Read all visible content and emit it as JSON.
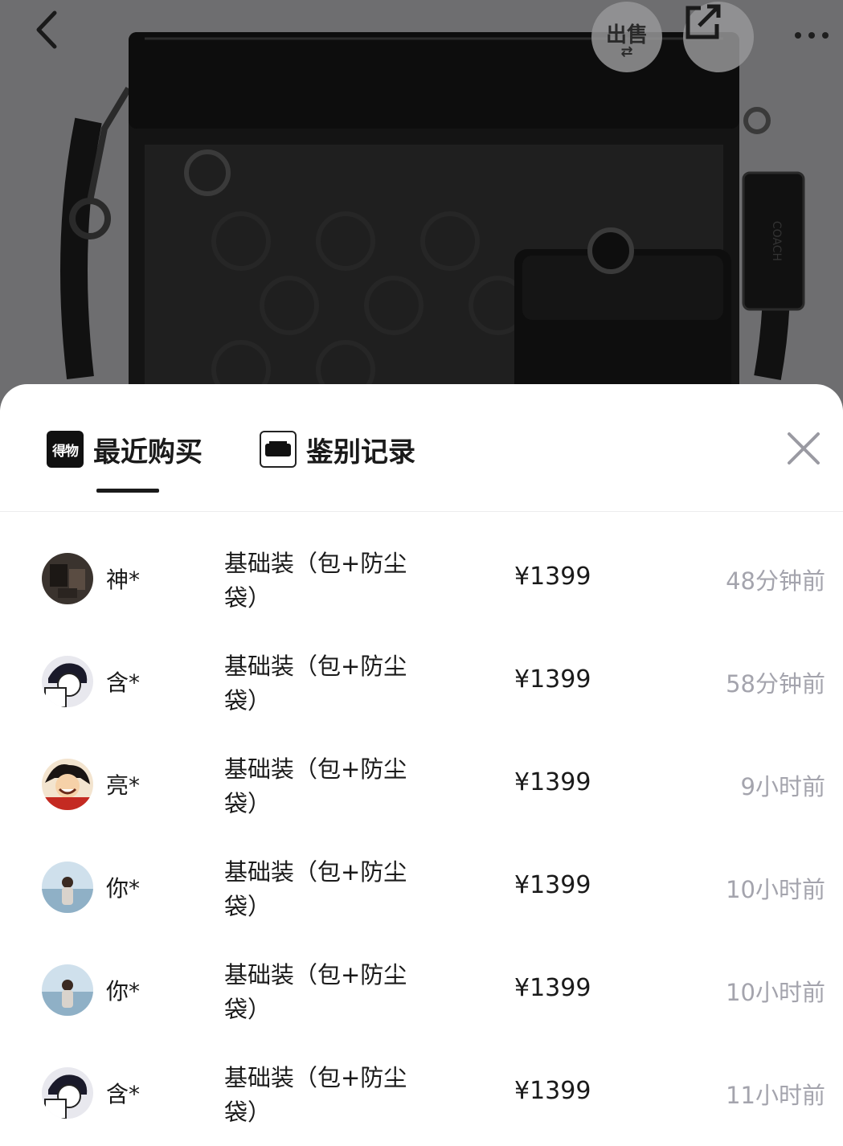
{
  "topbar": {
    "back_icon": "chevron-left-icon",
    "sell_label": "出售",
    "share_icon": "share-arrow-icon",
    "more_icon": "more-dots-icon"
  },
  "product_image": {
    "brand_tag": "COACH"
  },
  "sheet": {
    "tabs": [
      {
        "label": "最近购买",
        "icon_text": "得物",
        "active": true
      },
      {
        "label": "鉴别记录",
        "icon": "bag-thumbnail-icon",
        "active": false
      }
    ],
    "close_icon": "close-icon"
  },
  "records": [
    {
      "user": "神*",
      "spec": "基础装（包+防尘袋）",
      "price": "¥1399",
      "time": "48分钟前",
      "avatar": "dark-photo"
    },
    {
      "user": "含*",
      "spec": "基础装（包+防尘袋）",
      "price": "¥1399",
      "time": "58分钟前",
      "avatar": "anime-bw"
    },
    {
      "user": "亮*",
      "spec": "基础装（包+防尘袋）",
      "price": "¥1399",
      "time": "9小时前",
      "avatar": "anime-red"
    },
    {
      "user": "你*",
      "spec": "基础装（包+防尘袋）",
      "price": "¥1399",
      "time": "10小时前",
      "avatar": "beach-photo"
    },
    {
      "user": "你*",
      "spec": "基础装（包+防尘袋）",
      "price": "¥1399",
      "time": "10小时前",
      "avatar": "beach-photo"
    },
    {
      "user": "含*",
      "spec": "基础装（包+防尘袋）",
      "price": "¥1399",
      "time": "11小时前",
      "avatar": "anime-bw"
    }
  ],
  "colors": {
    "backdrop": "#6e6e70",
    "sheet_bg": "#ffffff",
    "text_primary": "#1a1a1a",
    "text_secondary": "#a4a4ad"
  }
}
